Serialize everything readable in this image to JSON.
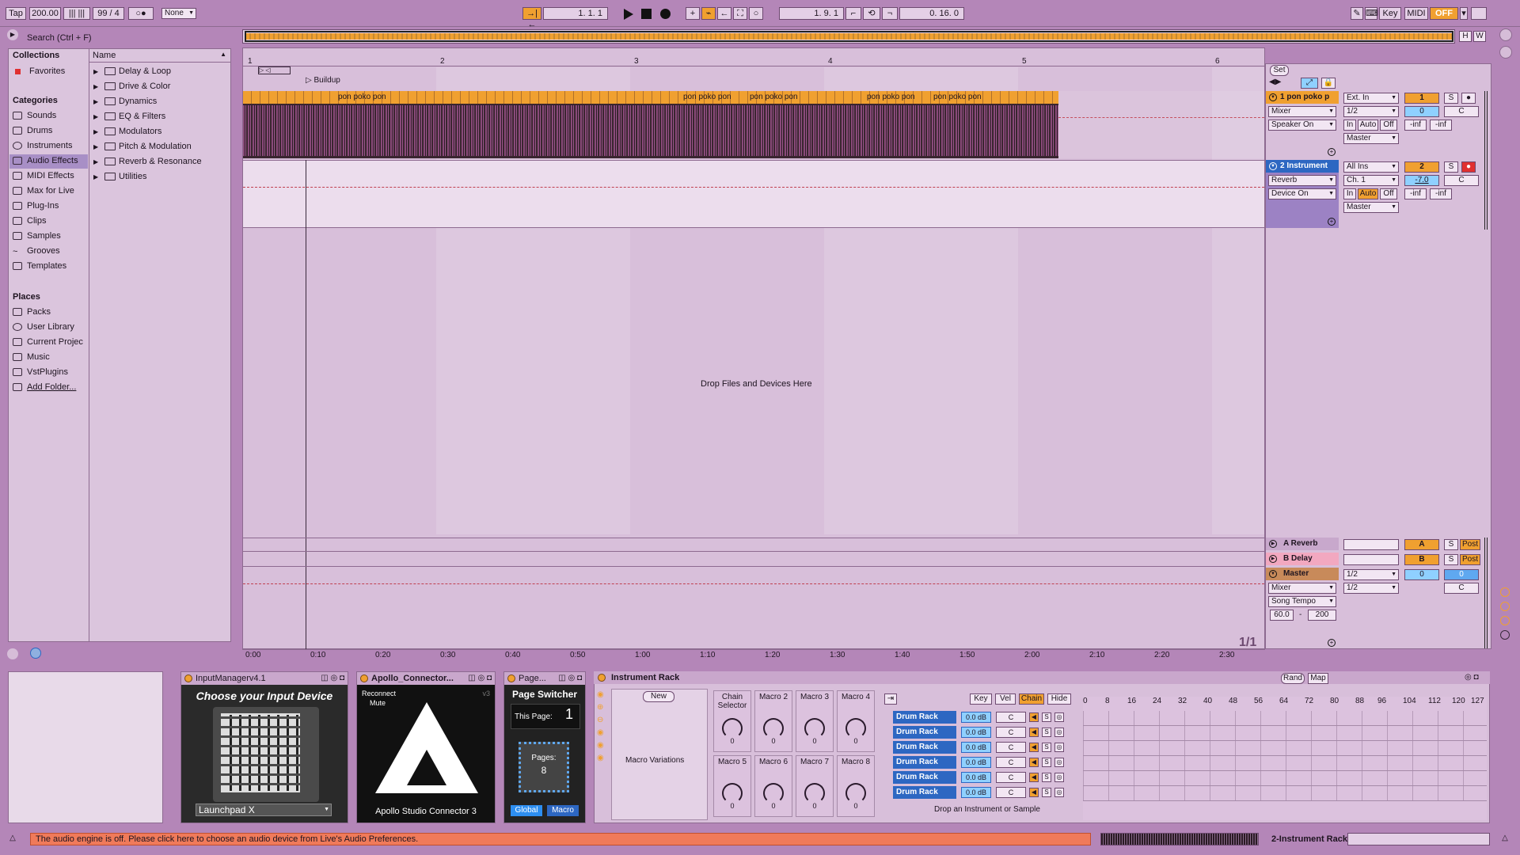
{
  "transport": {
    "tap": "Tap",
    "tempo": "200.00",
    "signature": "99 / 4",
    "quantize": "None",
    "position": "1.  1.  1",
    "loop_start": "1.  9.  1",
    "loop_length": "0.  16.  0",
    "key": "Key",
    "midi": "MIDI",
    "cpu_off": "OFF",
    "h_btn": "H",
    "w_btn": "W"
  },
  "browser": {
    "search_placeholder": "Search (Ctrl + F)",
    "collections_header": "Collections",
    "favorites": "Favorites",
    "categories_header": "Categories",
    "categories": [
      "Sounds",
      "Drums",
      "Instruments",
      "Audio Effects",
      "MIDI Effects",
      "Max for Live",
      "Plug-Ins",
      "Clips",
      "Samples",
      "Grooves",
      "Templates"
    ],
    "places_header": "Places",
    "places": [
      "Packs",
      "User Library",
      "Current Projec",
      "Music",
      "VstPlugins",
      "Add Folder..."
    ],
    "name_header": "Name",
    "folders": [
      "Delay & Loop",
      "Drive & Color",
      "Dynamics",
      "EQ & Filters",
      "Modulators",
      "Pitch & Modulation",
      "Reverb & Resonance",
      "Utilities"
    ]
  },
  "arrangement": {
    "bar_numbers": [
      "1",
      "2",
      "3",
      "4",
      "5",
      "6"
    ],
    "locator": "Buildup",
    "set_button": "Set",
    "drop_text": "Drop Files and Devices Here",
    "page_counter": "1/1",
    "time_labels": [
      "0:00",
      "0:10",
      "0:20",
      "0:30",
      "0:40",
      "0:50",
      "1:00",
      "1:10",
      "1:20",
      "1:30",
      "1:40",
      "1:50",
      "2:00",
      "2:10",
      "2:20",
      "2:30"
    ],
    "clip_labels": [
      "pon poko pon",
      "pon poko pon",
      "pon poko pon",
      "pon poko pon",
      "pon poko pon"
    ]
  },
  "tracks": {
    "t1": {
      "name": "1 pon poko p",
      "input": "Ext. In",
      "channel": "1/2",
      "monitor_mixer": "Mixer",
      "output_speaker": "Speaker On",
      "out": "Master",
      "number": "1",
      "solo": "S",
      "vol": "0",
      "pan": "C",
      "send_a": "-inf",
      "send_b": "-inf",
      "in": "In",
      "auto": "Auto",
      "off": "Off"
    },
    "t2": {
      "name": "2 Instrument",
      "input": "All Ins",
      "channel": "Ch. 1",
      "device": "Reverb",
      "device_on": "Device On",
      "out": "Master",
      "number": "2",
      "solo": "S",
      "vol": "-7.0",
      "pan": "C",
      "send_a": "-inf",
      "send_b": "-inf",
      "in": "In",
      "auto": "Auto",
      "off": "Off"
    },
    "ret_a": {
      "name": "A Reverb",
      "btn": "A",
      "solo": "S",
      "post": "Post"
    },
    "ret_b": {
      "name": "B Delay",
      "btn": "B",
      "solo": "S",
      "post": "Post"
    },
    "master": {
      "name": "Master",
      "ch1": "1/2",
      "ch2": "1/2",
      "mixer": "Mixer",
      "song_tempo": "Song Tempo",
      "tempo_min": "60.0",
      "tempo_max": "200",
      "vol": "0",
      "vol2": "0",
      "pan": "C"
    }
  },
  "devices": {
    "input_manager": {
      "title": "InputManagerv4.1",
      "heading": "Choose your Input Device",
      "selected": "Launchpad X"
    },
    "apollo": {
      "title": "Apollo_Connector...",
      "reconnect": "Reconnect",
      "mute": "Mute",
      "version": "v3",
      "label": "Apollo Studio Connector 3"
    },
    "page_switcher": {
      "title": "Page...",
      "heading": "Page Switcher",
      "this_page_label": "This Page:",
      "this_page": "1",
      "pages_label": "Pages:",
      "pages": "8",
      "global": "Global",
      "macro": "Macro"
    },
    "rack": {
      "title": "Instrument Rack",
      "rand": "Rand",
      "map": "Map",
      "new": "New",
      "macro_variations": "Macro Variations",
      "chain_selector": "Chain Selector",
      "macros": [
        "Macro 2",
        "Macro 3",
        "Macro 4",
        "Macro 5",
        "Macro 6",
        "Macro 7",
        "Macro 8"
      ],
      "macro_values": [
        "0",
        "0",
        "0",
        "0",
        "0",
        "0",
        "0",
        "0"
      ],
      "tabs": [
        "Key",
        "Vel",
        "Chain",
        "Hide"
      ],
      "chains": [
        "Drum Rack",
        "Drum Rack",
        "Drum Rack",
        "Drum Rack",
        "Drum Rack",
        "Drum Rack"
      ],
      "chain_volume": "0.0 dB",
      "chain_pan": "C",
      "chain_solo": "S",
      "drop_text": "Drop an Instrument or Sample",
      "ruler": [
        "0",
        "8",
        "16",
        "24",
        "32",
        "40",
        "48",
        "56",
        "64",
        "72",
        "80",
        "88",
        "96",
        "104",
        "112",
        "120",
        "127"
      ]
    }
  },
  "status": {
    "message": "The audio engine is off. Please click here to choose an audio device from Live's Audio Preferences.",
    "selected_track": "2-Instrument Rack"
  }
}
